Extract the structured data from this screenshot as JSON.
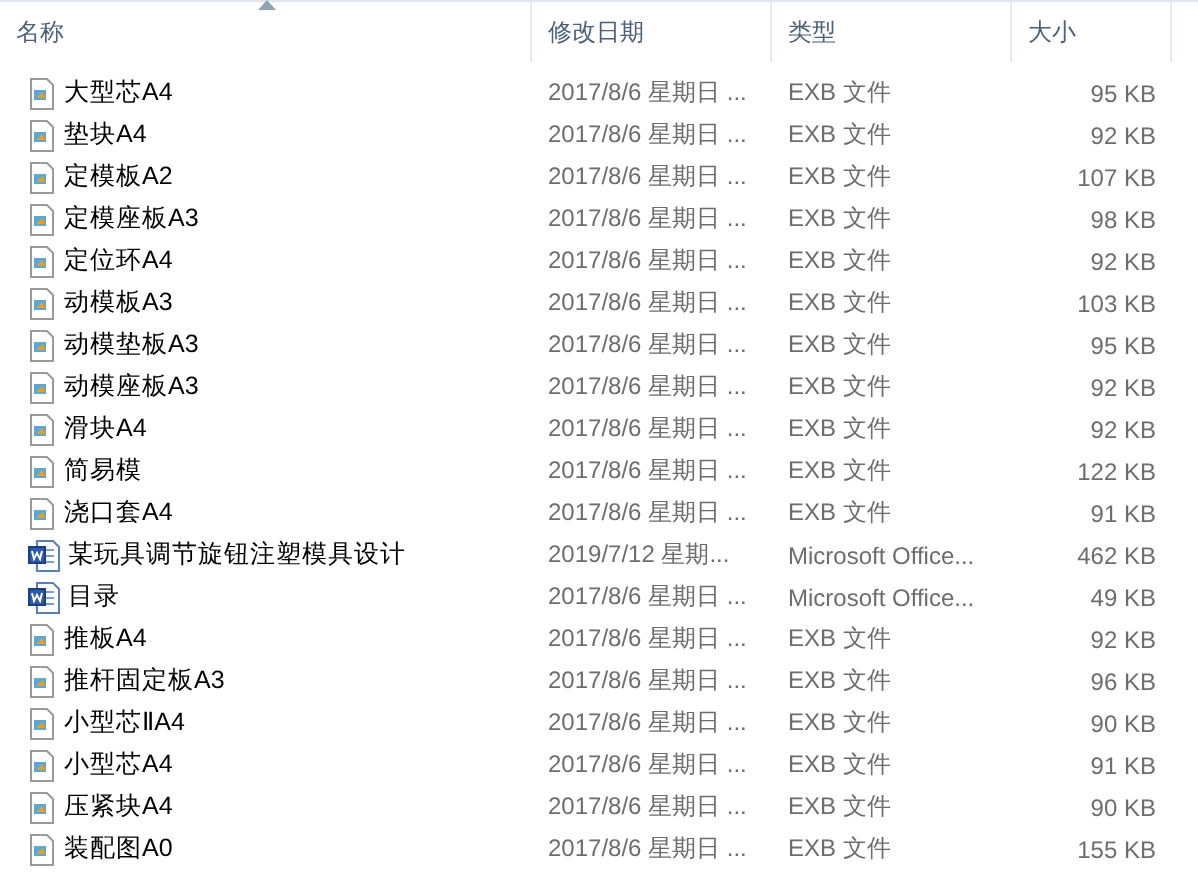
{
  "columns": [
    {
      "label": "名称",
      "sorted": true
    },
    {
      "label": "修改日期",
      "sorted": false
    },
    {
      "label": "类型",
      "sorted": false
    },
    {
      "label": "大小",
      "sorted": false
    }
  ],
  "rows": [
    {
      "kind": "exb",
      "name": "大型芯A4",
      "date": "2017/8/6 星期日 ...",
      "type": "EXB 文件",
      "size": "95 KB"
    },
    {
      "kind": "exb",
      "name": "垫块A4",
      "date": "2017/8/6 星期日 ...",
      "type": "EXB 文件",
      "size": "92 KB"
    },
    {
      "kind": "exb",
      "name": "定模板A2",
      "date": "2017/8/6 星期日 ...",
      "type": "EXB 文件",
      "size": "107 KB"
    },
    {
      "kind": "exb",
      "name": "定模座板A3",
      "date": "2017/8/6 星期日 ...",
      "type": "EXB 文件",
      "size": "98 KB"
    },
    {
      "kind": "exb",
      "name": "定位环A4",
      "date": "2017/8/6 星期日 ...",
      "type": "EXB 文件",
      "size": "92 KB"
    },
    {
      "kind": "exb",
      "name": "动模板A3",
      "date": "2017/8/6 星期日 ...",
      "type": "EXB 文件",
      "size": "103 KB"
    },
    {
      "kind": "exb",
      "name": "动模垫板A3",
      "date": "2017/8/6 星期日 ...",
      "type": "EXB 文件",
      "size": "95 KB"
    },
    {
      "kind": "exb",
      "name": "动模座板A3",
      "date": "2017/8/6 星期日 ...",
      "type": "EXB 文件",
      "size": "92 KB"
    },
    {
      "kind": "exb",
      "name": "滑块A4",
      "date": "2017/8/6 星期日 ...",
      "type": "EXB 文件",
      "size": "92 KB"
    },
    {
      "kind": "exb",
      "name": "简易模",
      "date": "2017/8/6 星期日 ...",
      "type": "EXB 文件",
      "size": "122 KB"
    },
    {
      "kind": "exb",
      "name": "浇口套A4",
      "date": "2017/8/6 星期日 ...",
      "type": "EXB 文件",
      "size": "91 KB"
    },
    {
      "kind": "word",
      "name": "某玩具调节旋钮注塑模具设计",
      "date": "2019/7/12 星期...",
      "type": "Microsoft Office...",
      "size": "462 KB"
    },
    {
      "kind": "word",
      "name": "目录",
      "date": "2017/8/6 星期日 ...",
      "type": "Microsoft Office...",
      "size": "49 KB"
    },
    {
      "kind": "exb",
      "name": "推板A4",
      "date": "2017/8/6 星期日 ...",
      "type": "EXB 文件",
      "size": "92 KB"
    },
    {
      "kind": "exb",
      "name": "推杆固定板A3",
      "date": "2017/8/6 星期日 ...",
      "type": "EXB 文件",
      "size": "96 KB"
    },
    {
      "kind": "exb",
      "name": "小型芯ⅡA4",
      "date": "2017/8/6 星期日 ...",
      "type": "EXB 文件",
      "size": "90 KB"
    },
    {
      "kind": "exb",
      "name": "小型芯A4",
      "date": "2017/8/6 星期日 ...",
      "type": "EXB 文件",
      "size": "91 KB"
    },
    {
      "kind": "exb",
      "name": "压紧块A4",
      "date": "2017/8/6 星期日 ...",
      "type": "EXB 文件",
      "size": "90 KB"
    },
    {
      "kind": "exb",
      "name": "装配图A0",
      "date": "2017/8/6 星期日 ...",
      "type": "EXB 文件",
      "size": "155 KB"
    }
  ]
}
